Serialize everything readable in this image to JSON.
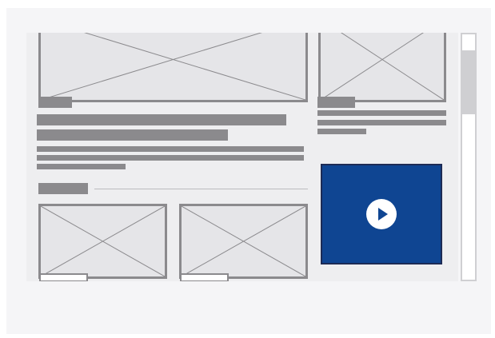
{
  "wireframe": {
    "content_regions": [
      "image-placeholder",
      "heading-lines",
      "body-text-lines",
      "section-divider",
      "card-grid",
      "sidebar-card",
      "video-player"
    ],
    "colors": {
      "canvas": "#f5f5f7",
      "content_background": "#eeeef0",
      "placeholder_fill": "#e5e5e8",
      "placeholder_stroke": "#8b8a8d",
      "video_background": "#0f4592",
      "video_border": "#1d2b55",
      "play_button": "#ffffff",
      "scrollbar": "#cfcfd2"
    },
    "icons": {
      "play": "play-icon",
      "image_placeholder": "image-placeholder-icon"
    },
    "scrollbar": {
      "position_fraction": 0.07,
      "visible_fraction": 0.26
    }
  }
}
